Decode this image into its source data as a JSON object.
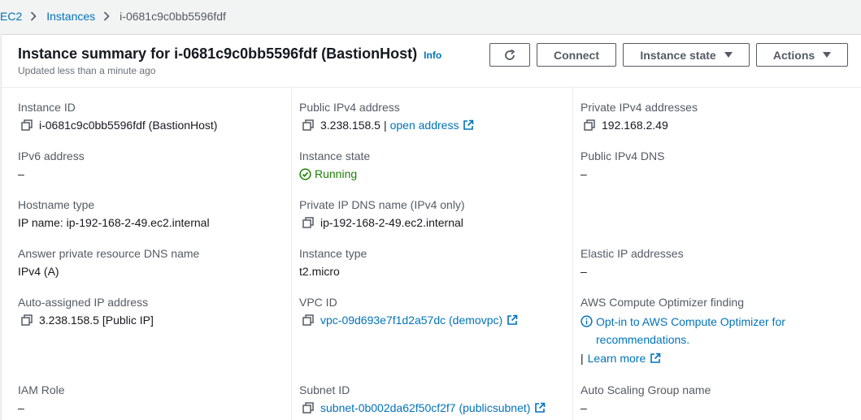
{
  "breadcrumb": {
    "root": "EC2",
    "section": "Instances",
    "current": "i-0681c9c0bb5596fdf"
  },
  "header": {
    "title": "Instance summary for i-0681c9c0bb5596fdf (BastionHost)",
    "info": "Info",
    "subtitle": "Updated less than a minute ago",
    "connect_label": "Connect",
    "instance_state_label": "Instance state",
    "actions_label": "Actions"
  },
  "fields": {
    "instance_id": {
      "label": "Instance ID",
      "value": "i-0681c9c0bb5596fdf (BastionHost)"
    },
    "public_ipv4": {
      "label": "Public IPv4 address",
      "value": "3.238.158.5",
      "separator": "|",
      "link": "open address"
    },
    "private_ipv4": {
      "label": "Private IPv4 addresses",
      "value": "192.168.2.49"
    },
    "ipv6": {
      "label": "IPv6 address",
      "value": "–"
    },
    "instance_state": {
      "label": "Instance state",
      "value": "Running"
    },
    "public_dns": {
      "label": "Public IPv4 DNS",
      "value": "–"
    },
    "hostname_type": {
      "label": "Hostname type",
      "value": "IP name: ip-192-168-2-49.ec2.internal"
    },
    "private_dns": {
      "label": "Private IP DNS name (IPv4 only)",
      "value": "ip-192-168-2-49.ec2.internal"
    },
    "answer_dns": {
      "label": "Answer private resource DNS name",
      "value": "IPv4 (A)"
    },
    "instance_type": {
      "label": "Instance type",
      "value": "t2.micro"
    },
    "elastic_ip": {
      "label": "Elastic IP addresses",
      "value": "–"
    },
    "auto_ip": {
      "label": "Auto-assigned IP address",
      "value": "3.238.158.5 [Public IP]"
    },
    "vpc_id": {
      "label": "VPC ID",
      "value": "vpc-09d693e7f1d2a57dc (demovpc)"
    },
    "optimizer": {
      "label": "AWS Compute Optimizer finding",
      "value": "Opt-in to AWS Compute Optimizer for recommendations.",
      "separator": "|",
      "learn_more": "Learn more"
    },
    "iam_role": {
      "label": "IAM Role",
      "value": "–"
    },
    "subnet_id": {
      "label": "Subnet ID",
      "value": "subnet-0b002da62f50cf2f7 (publicsubnet)"
    },
    "asg_name": {
      "label": "Auto Scaling Group name",
      "value": "–"
    }
  },
  "colors": {
    "link": "#0073bb",
    "success": "#1d8102",
    "button_border": "#545b64",
    "label": "#545b64"
  },
  "icons": {
    "copy": "copy-icon",
    "external": "external-link-icon",
    "refresh": "refresh-icon",
    "status_ok": "status-positive-icon",
    "info": "info-icon",
    "caret": "caret-down-icon",
    "breadcrumb_sep": "chevron-right-icon"
  }
}
